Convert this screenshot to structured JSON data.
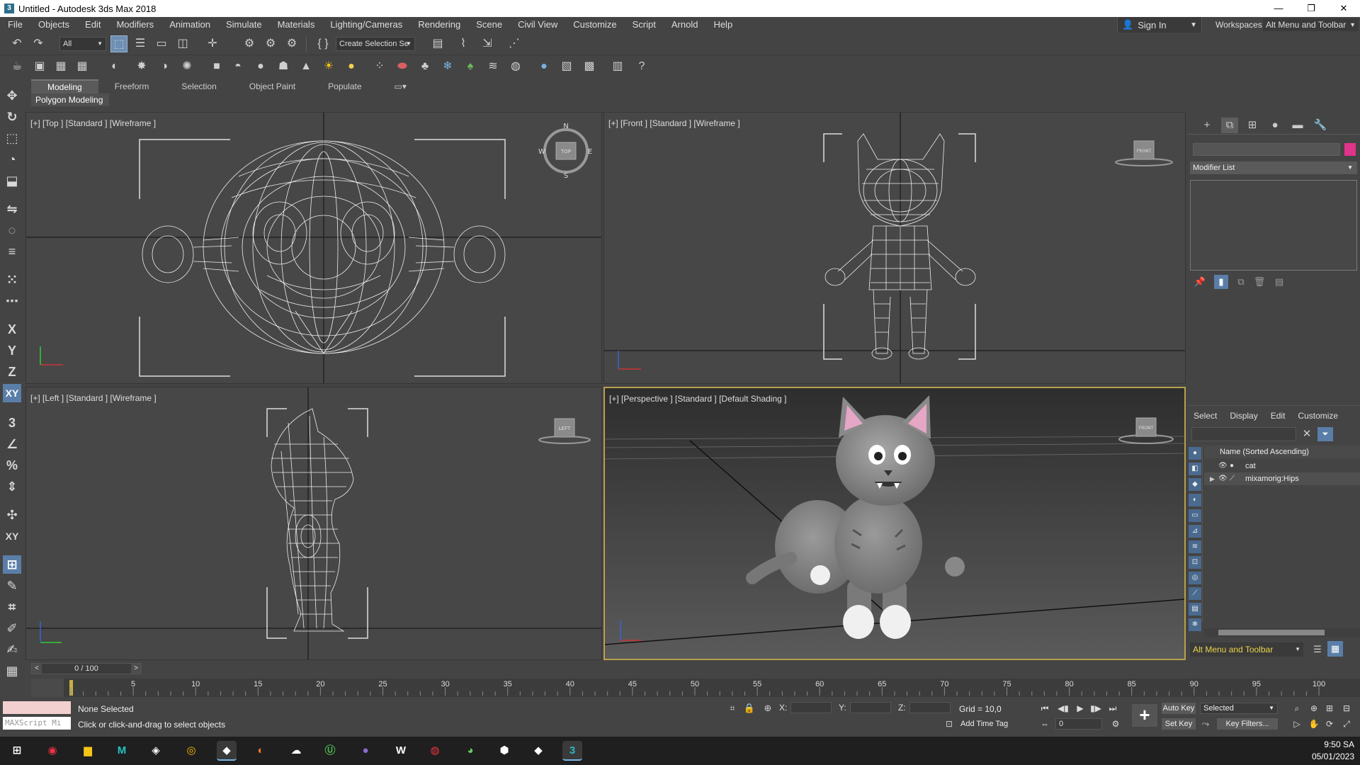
{
  "window": {
    "title": "Untitled - Autodesk 3ds Max 2018",
    "minimize": "—",
    "restore": "❐",
    "close": "✕"
  },
  "menu": [
    "File",
    "Objects",
    "Edit",
    "Modifiers",
    "Animation",
    "Simulate",
    "Materials",
    "Lighting/Cameras",
    "Rendering",
    "Scene",
    "Civil View",
    "Customize",
    "Script",
    "Arnold",
    "Help"
  ],
  "account": {
    "signin": "Sign In",
    "workspaces_label": "Workspaces:",
    "workspace": "Alt Menu and Toolbar"
  },
  "toolbar": {
    "filter": "All",
    "selection_set": "Create Selection Se"
  },
  "ribbon": {
    "tabs": [
      "Modeling",
      "Freeform",
      "Selection",
      "Object Paint",
      "Populate"
    ],
    "active_tab": "Modeling",
    "sub_panel": "Polygon Modeling"
  },
  "viewports": {
    "top": "[+] [Top ] [Standard ] [Wireframe ]",
    "front": "[+] [Front ] [Standard ] [Wireframe ]",
    "left": "[+] [Left ] [Standard ] [Wireframe ]",
    "perspective": "[+] [Perspective ] [Standard ] [Default Shading ]",
    "viewcube": {
      "top": "TOP",
      "front": "FRONT",
      "left": "LEFT",
      "compass_n": "N",
      "compass_s": "S",
      "compass_e": "E",
      "compass_w": "W"
    }
  },
  "command_panel": {
    "modifier_list": "Modifier List",
    "object_color": "#e0338a"
  },
  "scene_explorer": {
    "tabs": [
      "Select",
      "Display",
      "Edit",
      "Customize"
    ],
    "column": "Name (Sorted Ascending)",
    "rows": [
      "cat",
      "mixamorig:Hips"
    ],
    "workspace": "Alt Menu and Toolbar"
  },
  "timeline": {
    "frame": "0 / 100",
    "ticks": [
      "5",
      "10",
      "15",
      "20",
      "25",
      "30",
      "35",
      "40",
      "45",
      "50",
      "55",
      "60",
      "65",
      "70",
      "75",
      "80",
      "85",
      "90",
      "95",
      "100"
    ]
  },
  "status": {
    "maxscript_placeholder": "MAXScript Mi",
    "selection": "None Selected",
    "prompt": "Click or click-and-drag to select objects",
    "x_label": "X:",
    "y_label": "Y:",
    "z_label": "Z:",
    "grid": "Grid = 10,0",
    "add_time_tag": "Add Time Tag",
    "auto_key": "Auto Key",
    "set_key": "Set Key",
    "selected": "Selected",
    "key_filters": "Key Filters...",
    "frame_value": "0"
  },
  "clock": {
    "time": "9:50 SA",
    "date": "05/01/2023"
  },
  "colors": {
    "accent_yellow": "#b8a04a",
    "selected_blue": "#5a7ea8",
    "viewport_bg": "#474747"
  }
}
